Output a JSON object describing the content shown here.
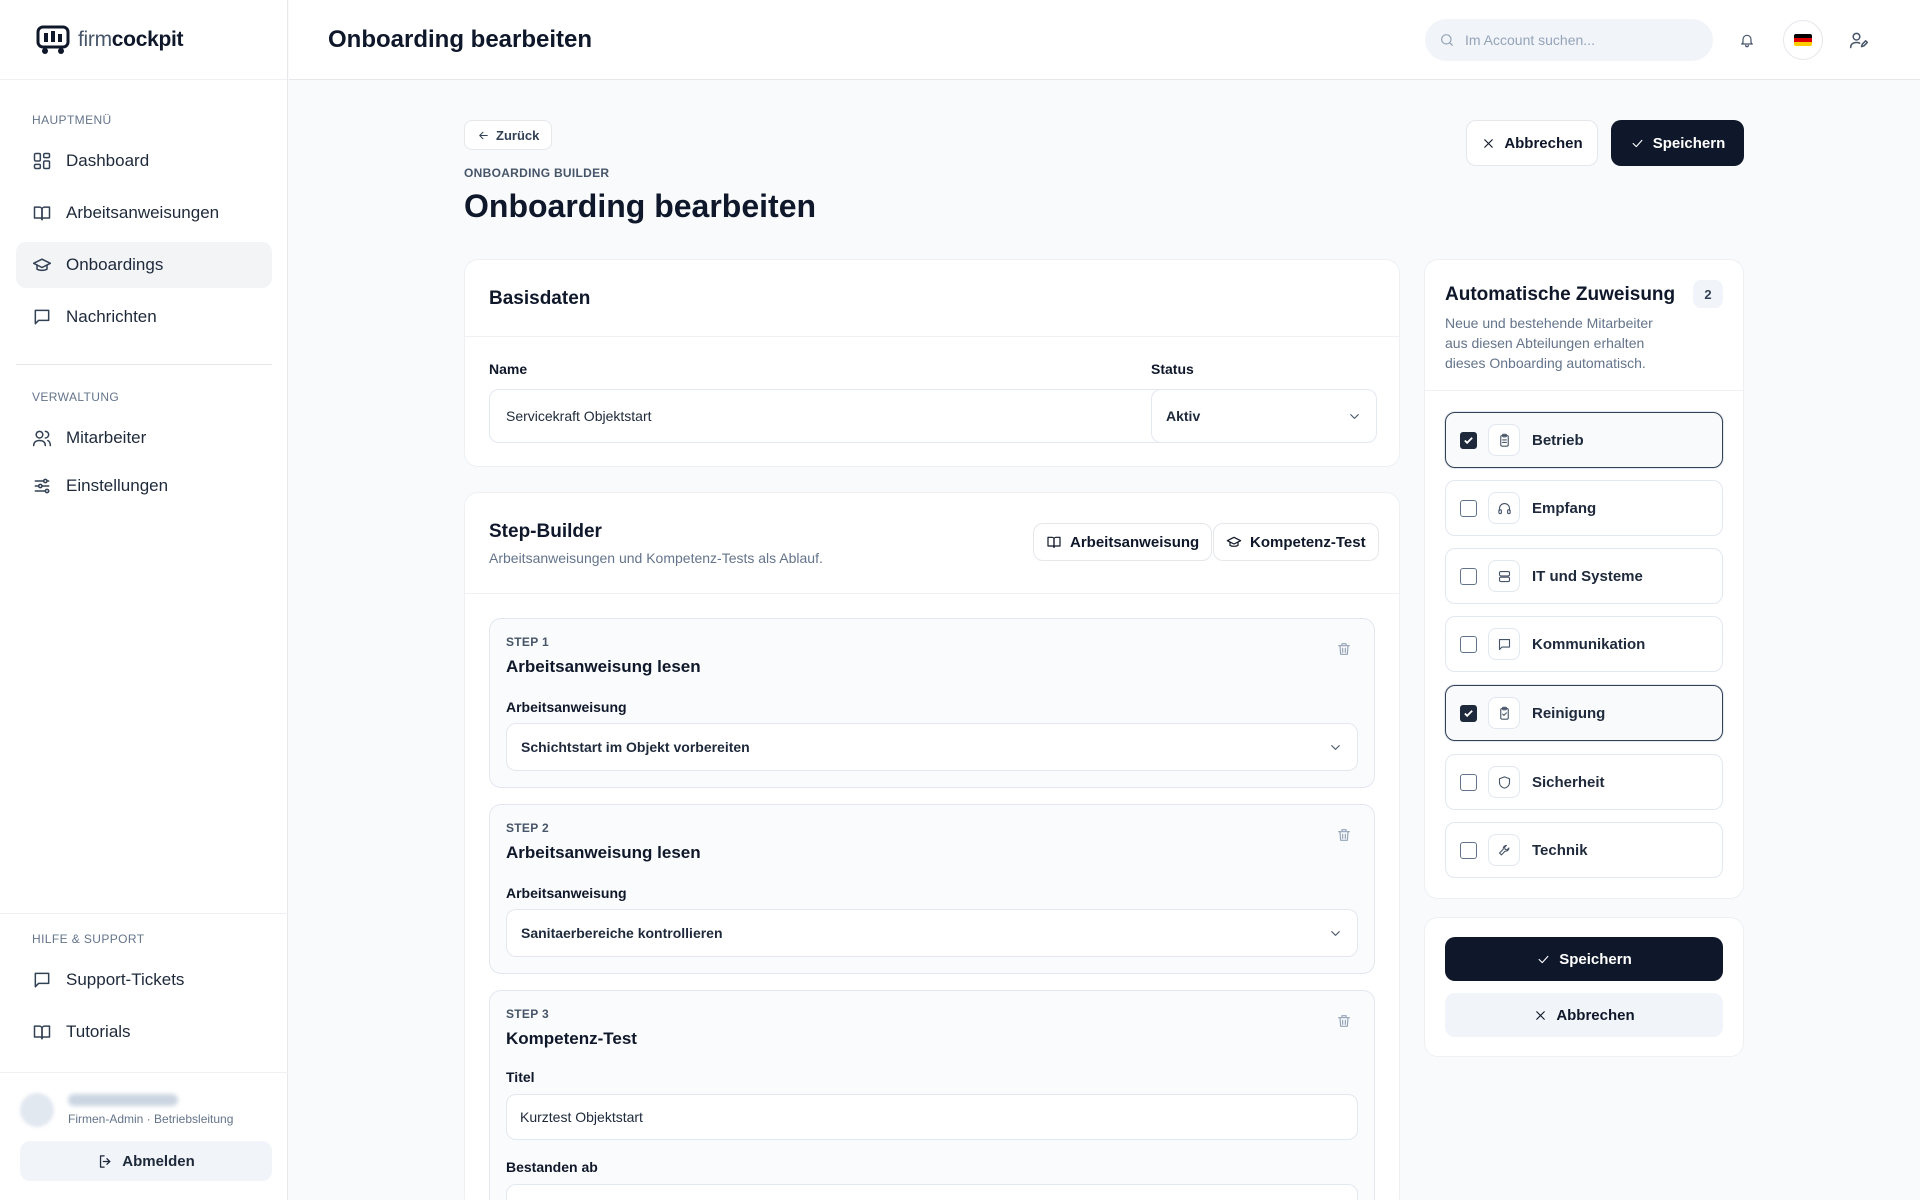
{
  "brand": {
    "name_light": "firm",
    "name_bold": "cockpit"
  },
  "sidebar": {
    "main_heading": "HAUPTMENÜ",
    "main_items": [
      {
        "label": "Dashboard",
        "icon": "dashboard-icon"
      },
      {
        "label": "Arbeitsanweisungen",
        "icon": "book-icon"
      },
      {
        "label": "Onboardings",
        "icon": "graduation-cap-icon",
        "active": true
      },
      {
        "label": "Nachrichten",
        "icon": "message-icon"
      }
    ],
    "admin_heading": "VERWALTUNG",
    "admin_items": [
      {
        "label": "Mitarbeiter",
        "icon": "users-icon"
      },
      {
        "label": "Einstellungen",
        "icon": "sliders-icon"
      }
    ],
    "help_heading": "HILFE & SUPPORT",
    "help_items": [
      {
        "label": "Support-Tickets",
        "icon": "message-icon"
      },
      {
        "label": "Tutorials",
        "icon": "book-icon"
      }
    ],
    "user_role": "Firmen-Admin · Betriebsleitung",
    "logout_label": "Abmelden"
  },
  "topbar": {
    "title": "Onboarding bearbeiten",
    "search_placeholder": "Im Account suchen..."
  },
  "header": {
    "back_label": "Zurück",
    "eyebrow": "ONBOARDING BUILDER",
    "title": "Onboarding bearbeiten",
    "cancel_label": "Abbrechen",
    "save_label": "Speichern"
  },
  "basics": {
    "title": "Basisdaten",
    "name_label": "Name",
    "name_value": "Servicekraft Objektstart",
    "status_label": "Status",
    "status_value": "Aktiv"
  },
  "builder": {
    "title": "Step-Builder",
    "subtitle": "Arbeitsanweisungen und Kompetenz-Tests als Ablauf.",
    "add_instruction_label": "Arbeitsanweisung",
    "add_test_label": "Kompetenz-Test",
    "steps": [
      {
        "number": "STEP 1",
        "title": "Arbeitsanweisung lesen",
        "field_label": "Arbeitsanweisung",
        "value": "Schichtstart im Objekt vorbereiten"
      },
      {
        "number": "STEP 2",
        "title": "Arbeitsanweisung lesen",
        "field_label": "Arbeitsanweisung",
        "value": "Sanitaerbereiche kontrollieren"
      },
      {
        "number": "STEP 3",
        "title": "Kompetenz-Test",
        "field_label": "Titel",
        "value": "Kurztest Objektstart",
        "pass_label": "Bestanden ab"
      }
    ]
  },
  "assignment": {
    "title": "Automatische Zuweisung",
    "count": "2",
    "description_lines": [
      "Neue und bestehende Mitarbeiter",
      "aus diesen Abteilungen erhalten",
      "dieses Onboarding automatisch."
    ],
    "departments": [
      {
        "label": "Betrieb",
        "checked": true,
        "icon": "clipboard-icon"
      },
      {
        "label": "Empfang",
        "checked": false,
        "icon": "headset-icon"
      },
      {
        "label": "IT und Systeme",
        "checked": false,
        "icon": "server-icon"
      },
      {
        "label": "Kommunikation",
        "checked": false,
        "icon": "message-icon"
      },
      {
        "label": "Reinigung",
        "checked": true,
        "icon": "clipboard-check-icon"
      },
      {
        "label": "Sicherheit",
        "checked": false,
        "icon": "shield-icon"
      },
      {
        "label": "Technik",
        "checked": false,
        "icon": "wrench-icon"
      }
    ]
  },
  "actions": {
    "save_label": "Speichern",
    "cancel_label": "Abbrechen"
  },
  "colors": {
    "primary": "#0f172a",
    "flag": [
      "#000000",
      "#dd0000",
      "#ffce00"
    ]
  }
}
